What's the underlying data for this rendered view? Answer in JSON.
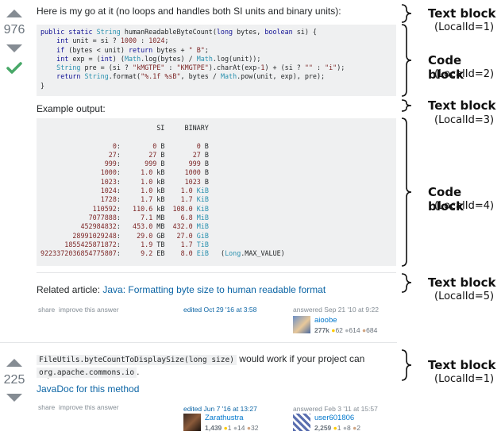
{
  "answer1": {
    "votes": "976",
    "intro": "Here is my go at it (no loops and handles both SI units and binary units):",
    "code_lines": [
      "public static String humanReadableByteCount(long bytes, boolean si) {",
      "    int unit = si ? 1000 : 1024;",
      "    if (bytes < unit) return bytes + \" B\";",
      "    int exp = (int) (Math.log(bytes) / Math.log(unit));",
      "    String pre = (si ? \"kMGTPE\" : \"KMGTPE\").charAt(exp-1) + (si ? \"\" : \"i\");",
      "    return String.format(\"%.1f %sB\", bytes / Math.pow(unit, exp), pre);",
      "}"
    ],
    "example_label": "Example output:",
    "output_header": "                              SI     BINARY",
    "output_rows": [
      "                   0:        0 B        0 B",
      "                  27:       27 B       27 B",
      "                 999:      999 B      999 B",
      "                1000:     1.0 kB     1000 B",
      "                1023:     1.0 kB     1023 B",
      "                1024:     1.0 kB    1.0 KiB",
      "                1728:     1.7 kB    1.7 KiB",
      "              110592:   110.6 kB  108.0 KiB",
      "             7077888:     7.1 MB    6.8 MiB",
      "           452984832:   453.0 MB  432.0 MiB",
      "         28991029248:    29.0 GB   27.0 GiB",
      "       1855425871872:     1.9 TB    1.7 TiB",
      " 9223372036854775807:     9.2 EB    8.0 EiB   (Long.MAX_VALUE)"
    ],
    "related_prefix": "Related article: ",
    "related_link": "Java: Formatting byte size to human readable format",
    "share": "share",
    "improve": "improve this answer",
    "edited": "edited Oct 29 '16 at 3:58",
    "answered": "answered Sep 21 '10 at 9:22",
    "user": "aioobe",
    "rep": "277k",
    "gold": "62",
    "silver": "614",
    "bronze": "684"
  },
  "answer2": {
    "votes": "225",
    "code1": "FileUtils.byteCountToDisplaySize(long size)",
    "text1": " would work if your project can depend on",
    "code2": "org.apache.commons.io",
    "text2": ".",
    "javadoc": "JavaDoc for this method",
    "share": "share",
    "improve": "improve this answer",
    "edited": "edited Jun 7 '16 at 13:27",
    "editor": "Zarathustra",
    "editor_rep": "1,439",
    "editor_gold": "1",
    "editor_silver": "14",
    "editor_bronze": "32",
    "answered": "answered Feb 3 '11 at 15:57",
    "user": "user601806",
    "rep": "2,259",
    "gold": "1",
    "silver": "8",
    "bronze": "2"
  },
  "annotations": [
    {
      "label": "Text block",
      "sub": "(LocalId=1)"
    },
    {
      "label": "Code block",
      "sub": "(LocalId=2)"
    },
    {
      "label": "Text block",
      "sub": "(LocalId=3)"
    },
    {
      "label": "Code block",
      "sub": "(LocalId=4)"
    },
    {
      "label": "Text block",
      "sub": "(LocalId=5)"
    },
    {
      "label": "Text block",
      "sub": "(LocalId=1)"
    }
  ],
  "colors": {
    "accepted": "#48a868",
    "link": "#0c65a5",
    "code_bg": "#eff0f1"
  }
}
